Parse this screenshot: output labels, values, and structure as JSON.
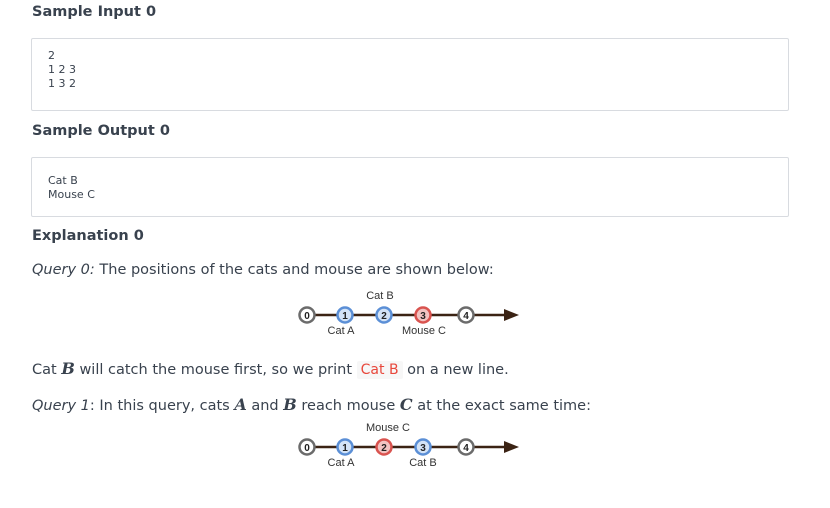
{
  "sample_input": {
    "title": "Sample Input 0",
    "lines": [
      "2",
      "1 2 3",
      "1 3 2"
    ]
  },
  "sample_output": {
    "title": "Sample Output 0",
    "lines": [
      "Cat B",
      "Mouse C"
    ]
  },
  "explanation": {
    "title": "Explanation 0",
    "query0": {
      "label": "Query 0:",
      "text": " The positions of the cats and mouse are shown below:"
    },
    "query0_result": {
      "part1": "Cat ",
      "var_b": "B",
      "part2": " will catch the mouse first, so we print ",
      "code": "Cat B",
      "part3": " on a new line."
    },
    "query1": {
      "label": "Query 1",
      "part1": ": In this query, cats ",
      "var_a": "A",
      "part2": " and ",
      "var_b": "B",
      "part3": " reach mouse ",
      "var_c": "C",
      "part4": " at the exact same time:"
    }
  },
  "diagram1": {
    "nodes": [
      "0",
      "1",
      "2",
      "3",
      "4"
    ],
    "node_styles": [
      "gray",
      "blue",
      "blue",
      "red",
      "gray"
    ],
    "label_above": "Cat B",
    "label_below_1": "Cat A",
    "label_below_2": "Mouse C"
  },
  "diagram2": {
    "nodes": [
      "0",
      "1",
      "2",
      "3",
      "4"
    ],
    "node_styles": [
      "gray",
      "blue",
      "red",
      "blue",
      "gray"
    ],
    "label_above": "Mouse C",
    "label_below_1": "Cat A",
    "label_below_2": "Cat B"
  },
  "colors": {
    "gray_stroke": "#6b6b6b",
    "blue_stroke": "#5b8fd6",
    "blue_fill": "#d3e3f7",
    "red_stroke": "#d9534f",
    "red_fill": "#f2c3c1",
    "line": "#3b2314"
  }
}
